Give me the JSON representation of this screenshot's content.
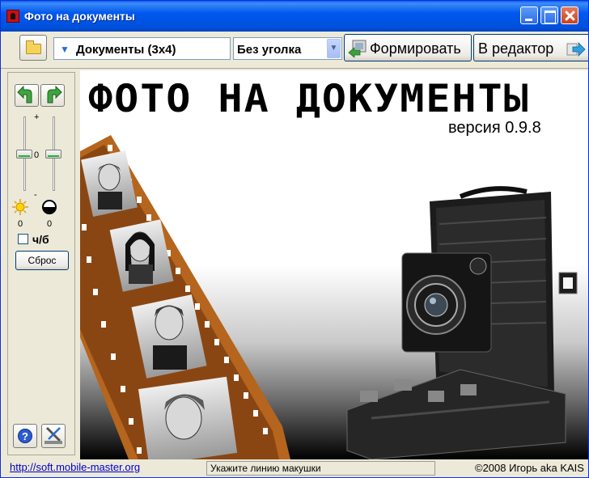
{
  "window": {
    "title": "Фото на документы"
  },
  "toolbar": {
    "document_type": "Документы (3x4)",
    "corner_option": "Без уголка",
    "form_label": "Формировать",
    "editor_label": "В редактор"
  },
  "leftpanel": {
    "plus_label": "+",
    "minus_label": "-",
    "zero_mid_label": "0",
    "brightness_value": "0",
    "contrast_value": "0",
    "brightness_level": 0,
    "contrast_level": 0,
    "bw_label": "ч/б",
    "bw_checked": false,
    "reset_label": "Сброс",
    "help_label": "?"
  },
  "splash": {
    "title": "ФОТО НА ДОКУМЕНТЫ",
    "version": "версия 0.9.8"
  },
  "statusbar": {
    "link": "http://soft.mobile-master.org",
    "hint": "Укажите линию макушки",
    "copyright": "©2008 Игорь aka KAIS"
  },
  "colors": {
    "title_bar": "#0058EE",
    "panel": "#ECE9D8",
    "link": "#0000CC",
    "film": "#B5651D"
  }
}
